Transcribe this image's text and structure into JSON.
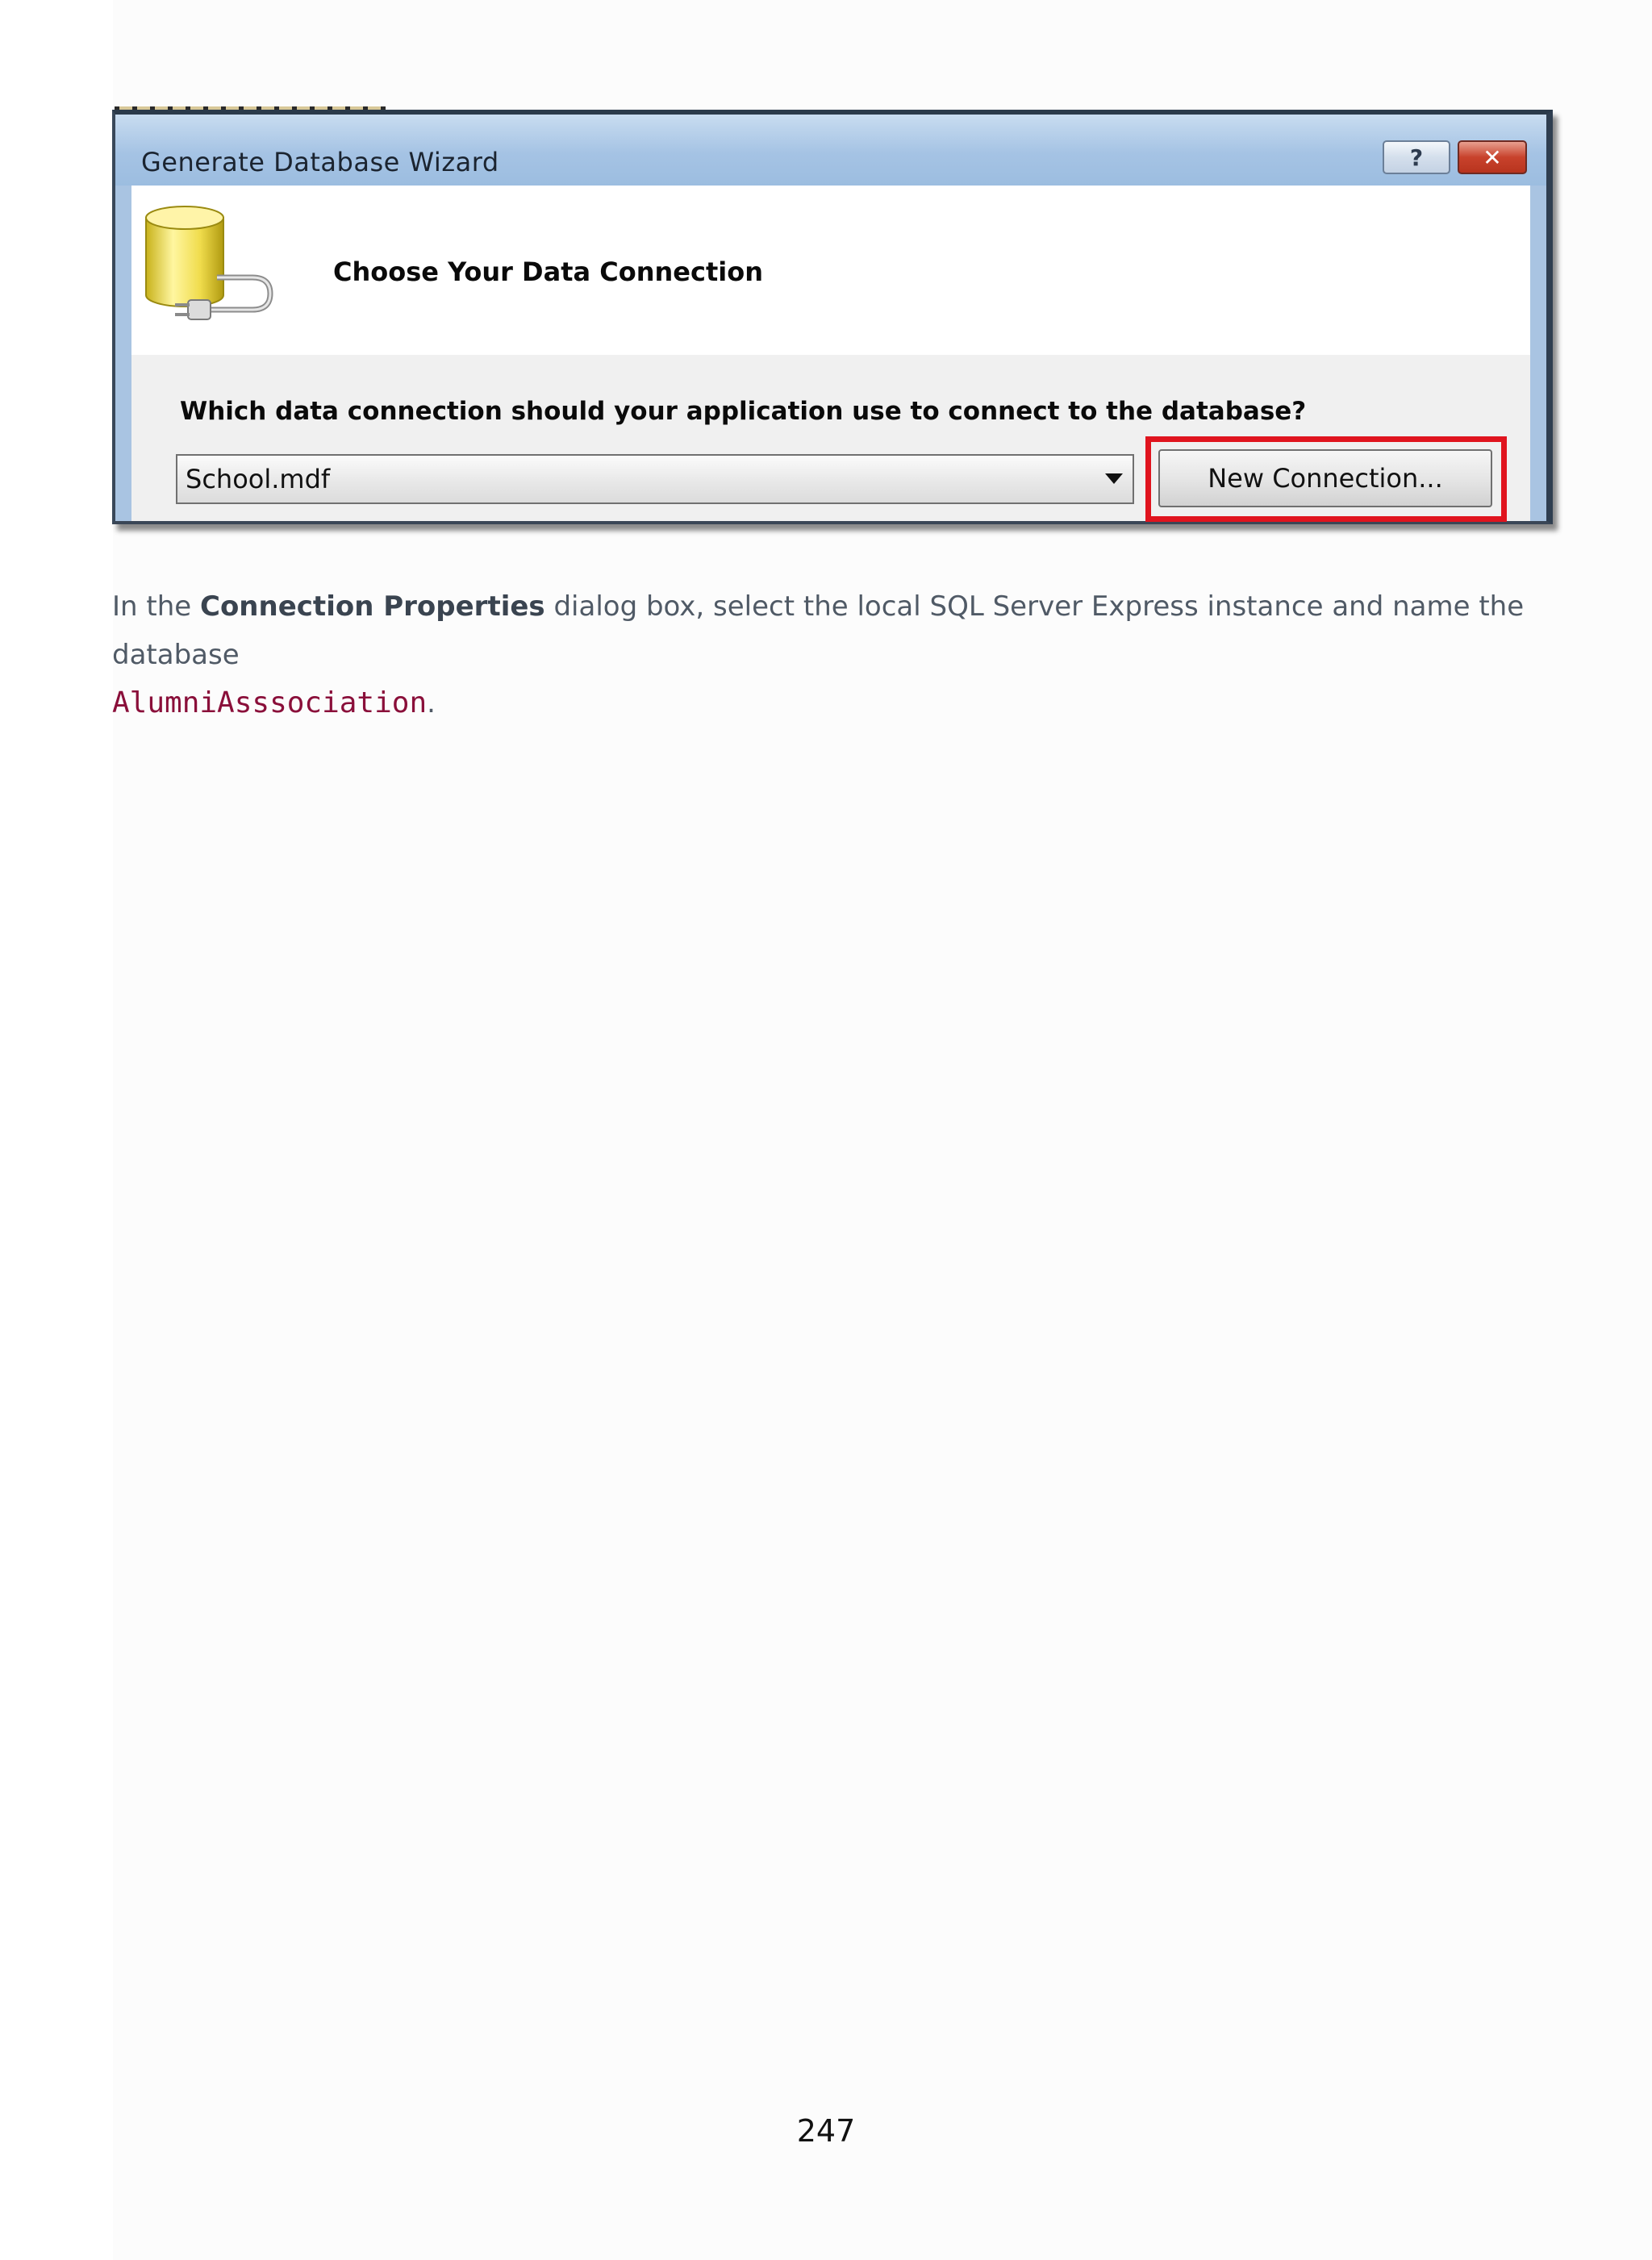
{
  "dialog": {
    "title": "Generate Database Wizard",
    "help_glyph": "?",
    "close_glyph": "✕",
    "header_title": "Choose Your Data Connection",
    "question": "Which data connection should your application use to connect to the database?",
    "connection_value": "School.mdf",
    "new_connection_label": "New Connection...",
    "icon": "database-plug-icon",
    "highlight_color": "#e0141e"
  },
  "paragraph": {
    "before": "In the ",
    "bold": "Connection Properties",
    "middle": " dialog box, select the local SQL Server Express instance and name the database ",
    "code": "AlumniAsssociation",
    "after": "."
  },
  "page_number": "247"
}
